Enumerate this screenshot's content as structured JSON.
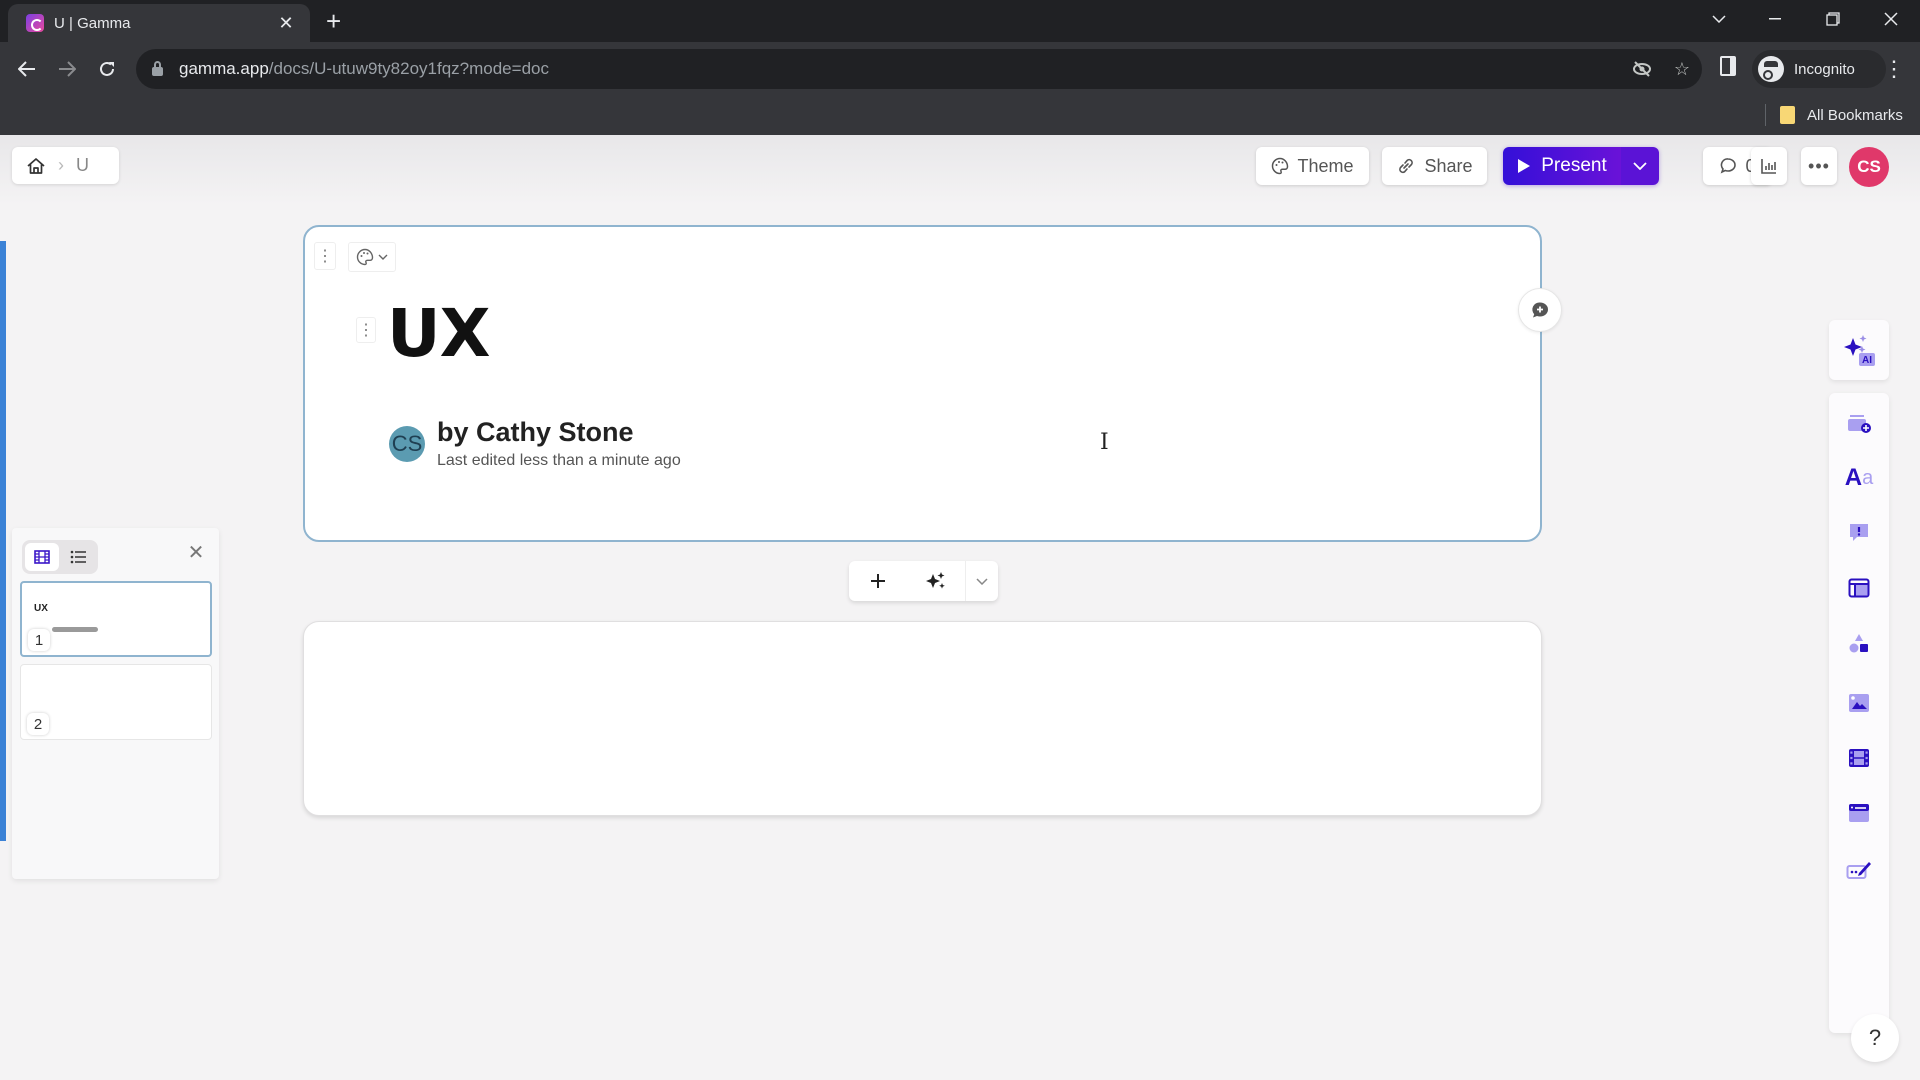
{
  "browser": {
    "tab_title": "U | Gamma",
    "url_host": "gamma.app",
    "url_path": "/docs/U-utuw9ty82oy1fqz?mode=doc",
    "profile_label": "Incognito",
    "bookmarks_label": "All Bookmarks"
  },
  "header": {
    "breadcrumb": {
      "current": "U"
    },
    "theme_label": "Theme",
    "share_label": "Share",
    "present_label": "Present",
    "comment_count": "0",
    "user_initials": "CS",
    "accent_color": "#4b12d8"
  },
  "cards": [
    {
      "title": "UX",
      "author_initials": "CS",
      "author_line": "by Cathy Stone",
      "edited_text": "Last edited less than a minute ago"
    },
    {
      "title": ""
    }
  ],
  "panel": {
    "thumbnails": [
      {
        "number": "1",
        "title": "UX"
      },
      {
        "number": "2",
        "title": ""
      }
    ]
  },
  "rail": {
    "ai_badge": "AI",
    "items": [
      "add-card",
      "text-styles",
      "callout",
      "layout",
      "shapes",
      "image",
      "video",
      "embed",
      "forms"
    ]
  },
  "help_label": "?"
}
